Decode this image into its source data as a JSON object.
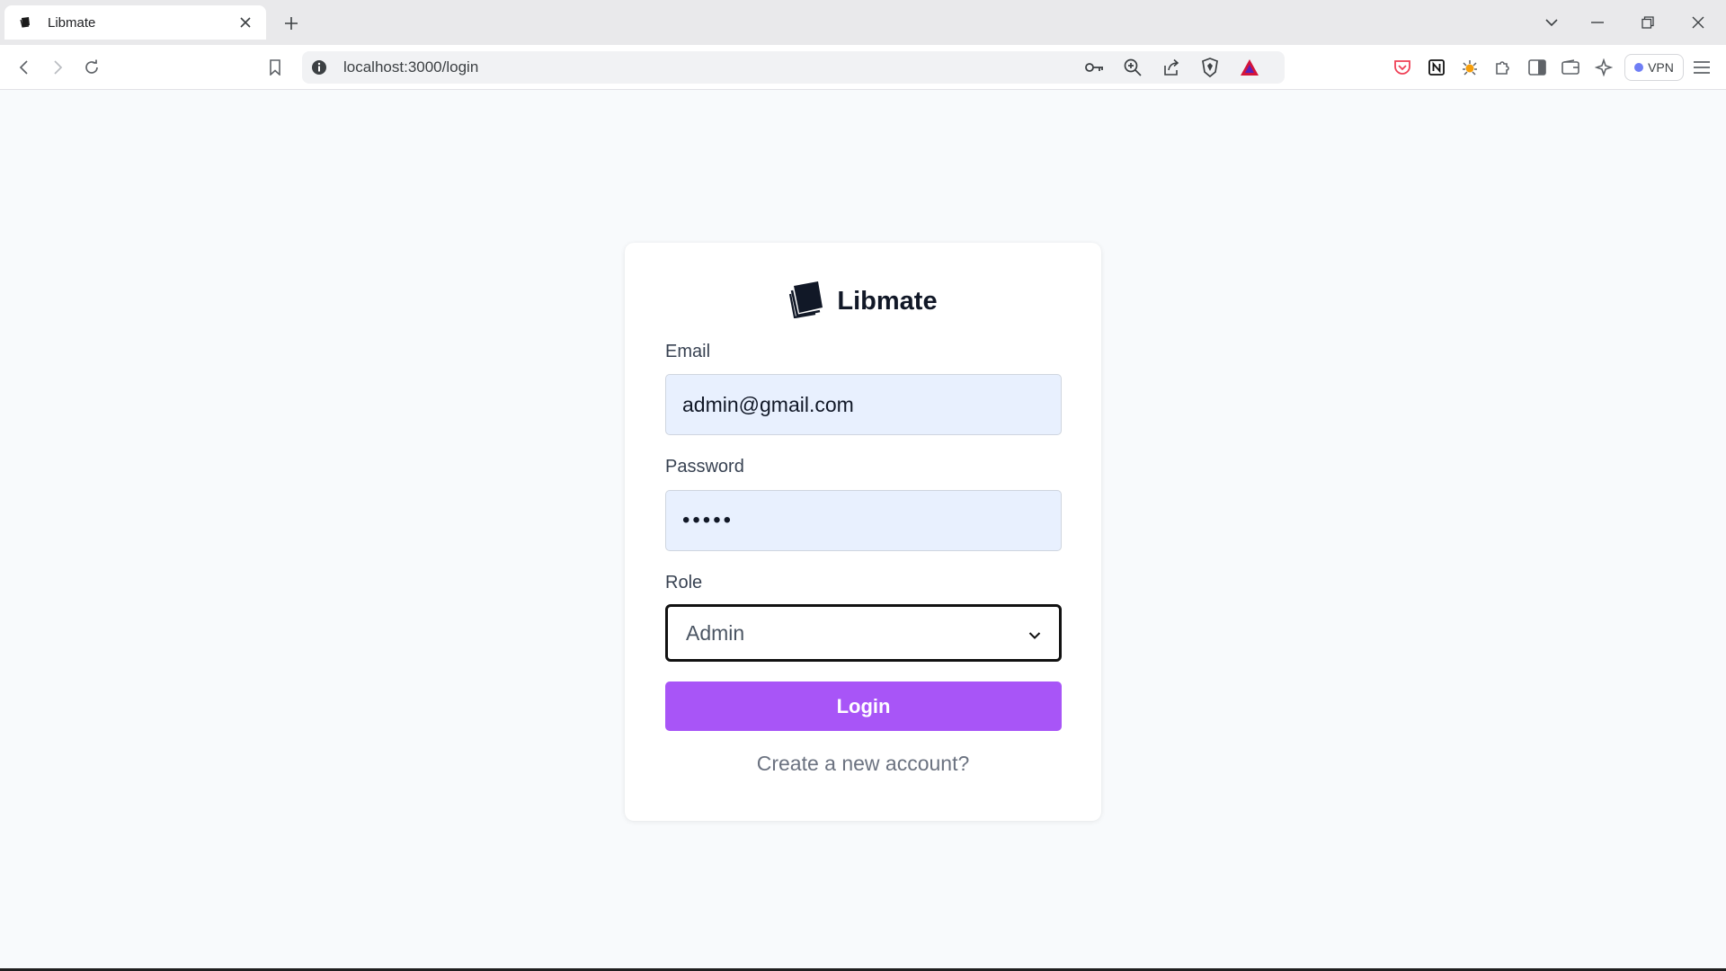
{
  "browser": {
    "tab_title": "Libmate",
    "url": "localhost:3000/login",
    "vpn_label": "VPN"
  },
  "app": {
    "brand_name": "Libmate",
    "accent_color": "#a855f7"
  },
  "form": {
    "email_label": "Email",
    "email_value": "admin@gmail.com",
    "password_label": "Password",
    "password_value": "•••••",
    "role_label": "Role",
    "role_value": "Admin",
    "login_label": "Login",
    "create_account_link": "Create a new account?"
  },
  "icons": {
    "brand": "book-stack-icon",
    "select_arrow": "chevron-down-icon"
  }
}
